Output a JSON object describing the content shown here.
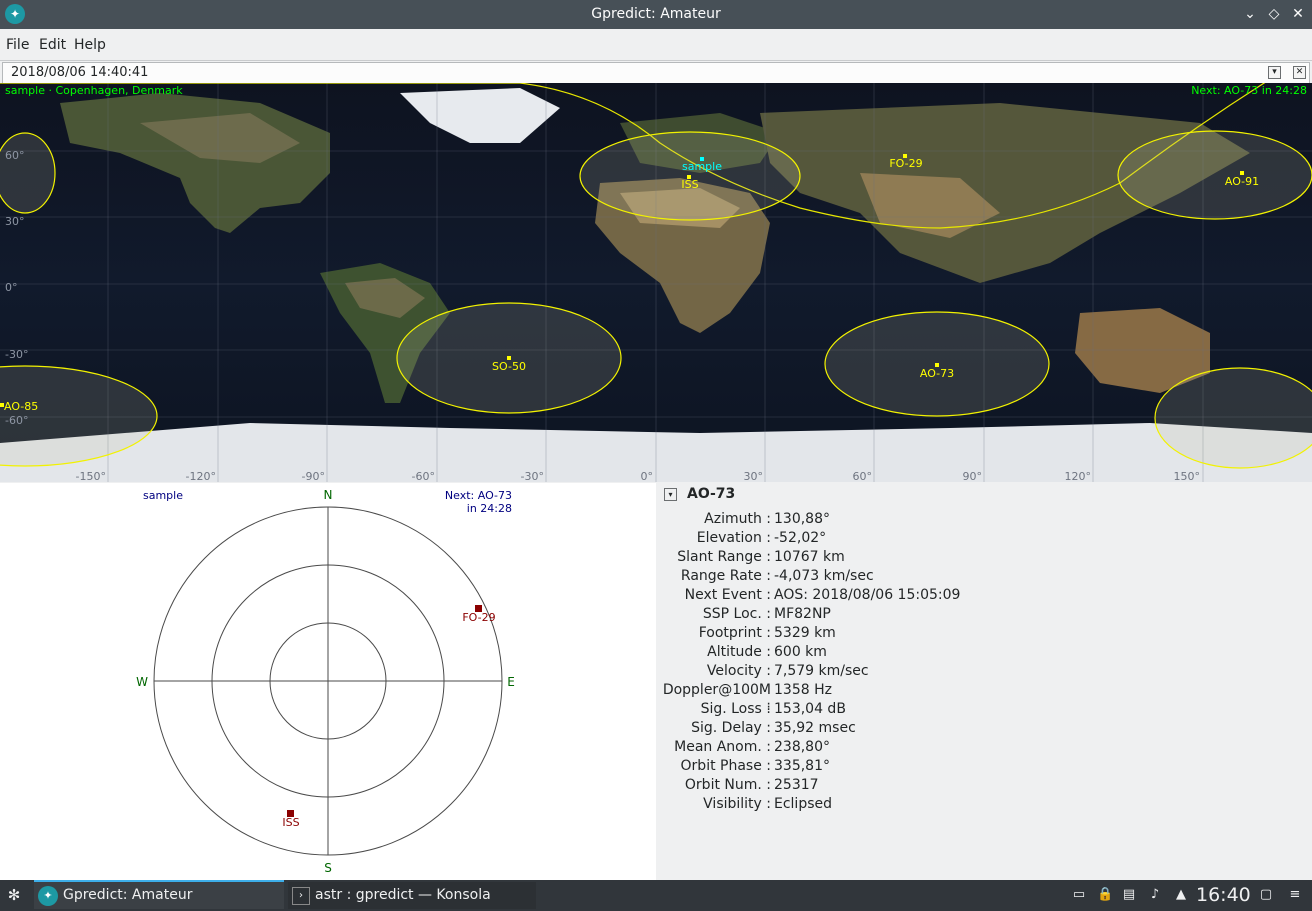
{
  "window": {
    "title": "Gpredict: Amateur"
  },
  "menu": {
    "file": "File",
    "edit": "Edit",
    "help": "Help"
  },
  "time": {
    "value": "2018/08/06 14:40:41"
  },
  "map": {
    "location_label": "sample · Copenhagen, Denmark",
    "next_label": "Next: AO-73 in 24:28",
    "lat_labels": [
      "60°",
      "30°",
      "0°",
      "-30°",
      "-60°"
    ],
    "lon_labels": [
      "-150°",
      "-120°",
      "-90°",
      "-60°",
      "-30°",
      "0°",
      "30°",
      "60°",
      "90°",
      "120°",
      "150°"
    ],
    "ground_station": "sample",
    "satellites": {
      "iss": "ISS",
      "fo29": "FO-29",
      "ao91": "AO-91",
      "so50": "SO-50",
      "ao73": "AO-73",
      "ao85": "AO-85"
    },
    "colors": {
      "footprint": "#ffff00",
      "label_green": "#00ff00",
      "qth": "#00ffff"
    }
  },
  "polar": {
    "qth": "sample",
    "next_line1": "Next: AO-73",
    "next_line2": "in 24:28",
    "north": "N",
    "south": "S",
    "east": "E",
    "west": "W",
    "sat1": "FO-29",
    "sat2": "ISS"
  },
  "info": {
    "satellite": "AO-73",
    "rows": [
      {
        "label": "Azimuth :",
        "value": "130,88°"
      },
      {
        "label": "Elevation :",
        "value": "-52,02°"
      },
      {
        "label": "Slant Range :",
        "value": "10767 km"
      },
      {
        "label": "Range Rate :",
        "value": "-4,073 km/sec"
      },
      {
        "label": "Next Event :",
        "value": "AOS: 2018/08/06 15:05:09"
      },
      {
        "label": "SSP Loc. :",
        "value": "MF82NP"
      },
      {
        "label": "Footprint :",
        "value": "5329 km"
      },
      {
        "label": "Altitude :",
        "value": "600 km"
      },
      {
        "label": "Velocity :",
        "value": "7,579 km/sec"
      },
      {
        "label": "Doppler@100M :",
        "value": "1358 Hz"
      },
      {
        "label": "Sig. Loss :",
        "value": "153,04 dB"
      },
      {
        "label": "Sig. Delay :",
        "value": "35,92 msec"
      },
      {
        "label": "Mean Anom. :",
        "value": "238,80°"
      },
      {
        "label": "Orbit Phase :",
        "value": "335,81°"
      },
      {
        "label": "Orbit Num. :",
        "value": "25317"
      },
      {
        "label": "Visibility :",
        "value": "Eclipsed"
      }
    ]
  },
  "taskbar": {
    "task1": "Gpredict: Amateur",
    "task2": "astr : gpredict — Konsola",
    "clock": "16:40"
  }
}
